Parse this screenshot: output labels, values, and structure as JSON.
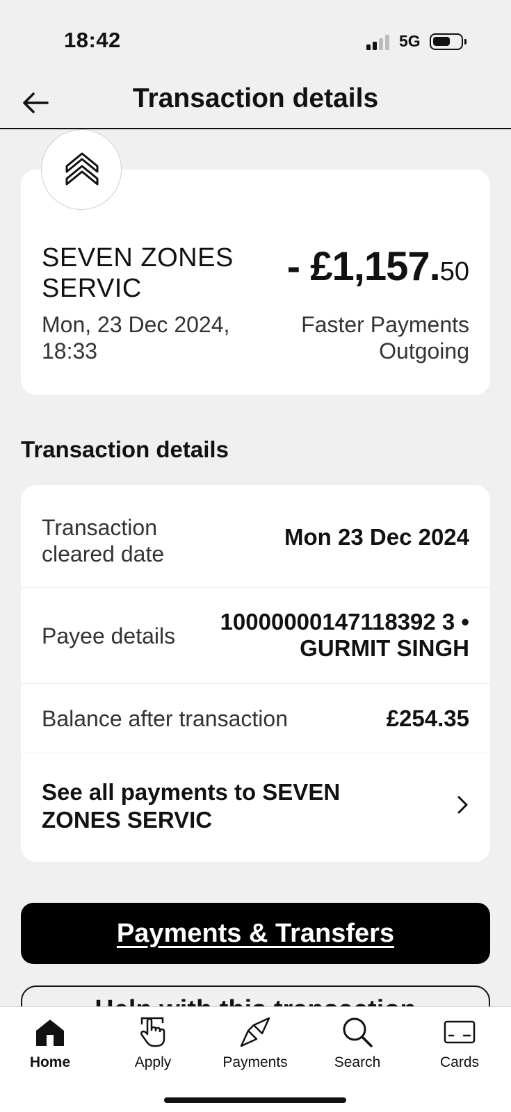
{
  "status_bar": {
    "time": "18:42",
    "network": "5G"
  },
  "header": {
    "title": "Transaction details",
    "back_icon": "arrow-left-icon"
  },
  "transaction": {
    "merchant": "SEVEN ZONES SERVIC",
    "date": "Mon, 23 Dec 2024, 18:33",
    "amount_major": "- £1,157.",
    "amount_minor": "50",
    "payment_type": "Faster Payments Outgoing",
    "logo_icon": "double-chevron-up-icon"
  },
  "details": {
    "section_title": "Transaction details",
    "rows": [
      {
        "label": "Transaction cleared date",
        "value": "Mon 23 Dec 2024"
      },
      {
        "label": "Payee details",
        "value": "10000000147118392 3 • GURMIT SINGH"
      },
      {
        "label": "Balance after transaction",
        "value": "£254.35"
      }
    ],
    "see_all": "See all payments to SEVEN ZONES SERVIC"
  },
  "actions": {
    "primary": "Payments & Transfers",
    "secondary": "Help with this transaction"
  },
  "tabs": [
    {
      "label": "Home",
      "icon": "home-icon",
      "active": true
    },
    {
      "label": "Apply",
      "icon": "tap-hand-icon",
      "active": false
    },
    {
      "label": "Payments",
      "icon": "payments-icon",
      "active": false
    },
    {
      "label": "Search",
      "icon": "search-icon",
      "active": false
    },
    {
      "label": "Cards",
      "icon": "card-icon",
      "active": false
    }
  ],
  "colors": {
    "background": "#f0f0f0",
    "card": "#ffffff",
    "primary_button": "#000000",
    "text": "#111111"
  }
}
